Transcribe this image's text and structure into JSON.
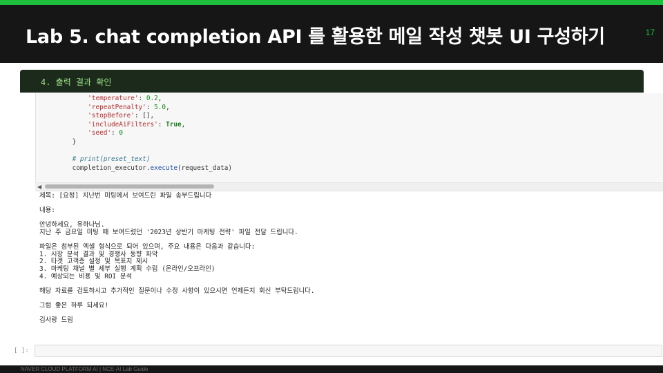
{
  "slide": {
    "title": "Lab 5. chat completion API 를 활용한 메일 작성 챗봇 UI 구성하기",
    "page_number": "17",
    "footer": "NAVER CLOUD PLATFORM AI  |  NCE-AI Lab Guide",
    "accent_color": "#1fbf3e",
    "header_bg": "#161616"
  },
  "notebook": {
    "section_label": "4. 출력 결과 확인",
    "code": {
      "line1_key": "'temperature'",
      "line1_val": "0.2",
      "line2_key": "'repeatPenalty'",
      "line2_val": "5.0",
      "line3_key": "'stopBefore'",
      "line3_val": "[]",
      "line4_key": "'includeAiFilters'",
      "line4_val": "True",
      "line5_key": "'seed'",
      "line5_val": "0",
      "close_brace": "}",
      "comment": "# print(preset_text)",
      "call_obj": "completion_executor.",
      "call_fn": "execute",
      "call_args": "(request_data)"
    },
    "output": {
      "subject": "제목: [요청] 지난번 미팅에서 보여드린 파일 송부드립니다",
      "body_label": "내용:",
      "greeting": "안녕하세요, 유하나님.",
      "intro": "지난 주 금요일 미팅 때 보여드렸던 '2023년 상반기 마케팅 전략' 파일 전달 드립니다.",
      "detail_intro": "파일은 첨부된 엑셀 형식으로 되어 있으며, 주요 내용은 다음과 같습니다:",
      "item1": "1. 시장 분석 결과 및 경쟁사 동향 파악",
      "item2": "2. 타겟 고객층 설정 및 목표치 제시",
      "item3": "3. 마케팅 채널 별 세부 실행 계획 수립 (온라인/오프라인)",
      "item4": "4. 예상되는 비용 및 ROI 분석",
      "request": "해당 자료를 검토하시고 추가적인 질문이나 수정 사항이 있으시면 언제든지 회신 부탁드립니다.",
      "closing": "그럼 좋은 하루 되세요!",
      "signature": "김사랑 드림"
    },
    "empty_cell_prompt": "[ ]:"
  }
}
